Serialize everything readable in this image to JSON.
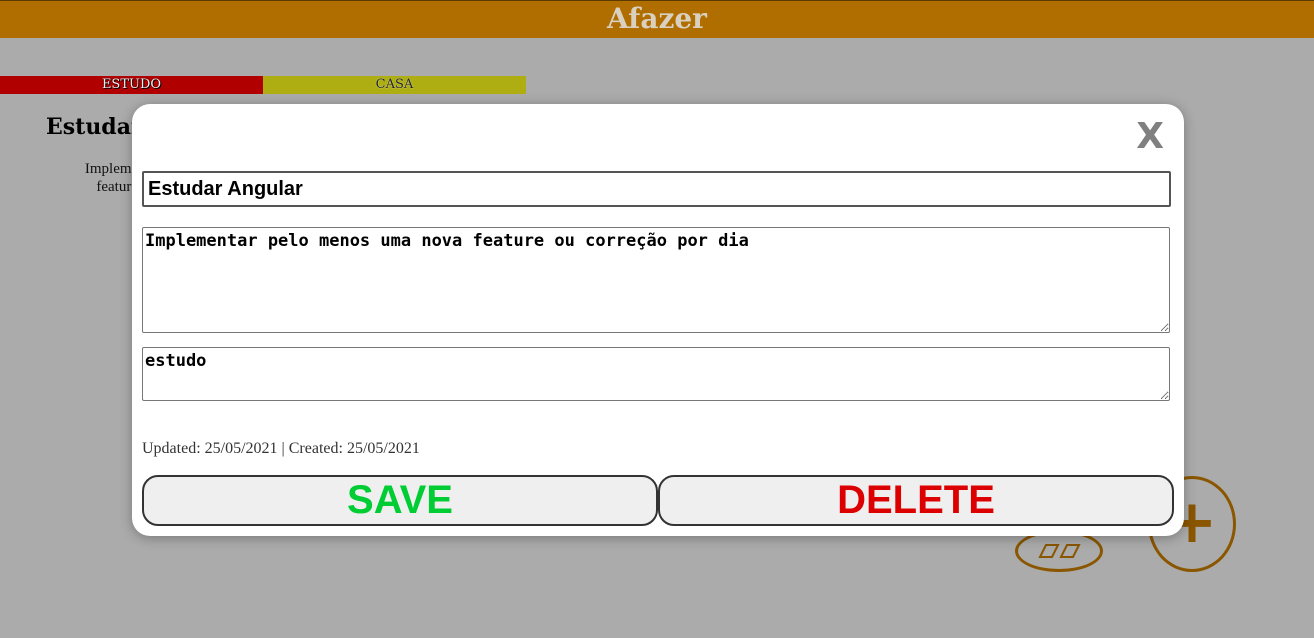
{
  "app": {
    "title": "Afazer"
  },
  "tabs": [
    {
      "label": "ESTUDO",
      "color": "#b00000"
    },
    {
      "label": "CASA",
      "color": "#aeae12"
    }
  ],
  "background_card": {
    "title": "Estudar",
    "description": "Implementar pelo\nfeature ou cor"
  },
  "modal": {
    "close_label": "X",
    "title_value": "Estudar Angular",
    "description_value": "Implementar pelo menos uma nova feature ou correção por dia",
    "tag_value": "estudo",
    "meta": "Updated: 25/05/2021 | Created: 25/05/2021",
    "save_label": "SAVE",
    "delete_label": "DELETE"
  },
  "fab": {
    "view_icon": "cards-view-icon",
    "add_icon": "plus-icon"
  },
  "colors": {
    "header": "#b06e00",
    "save": "#00cc33",
    "delete": "#dd0000"
  }
}
